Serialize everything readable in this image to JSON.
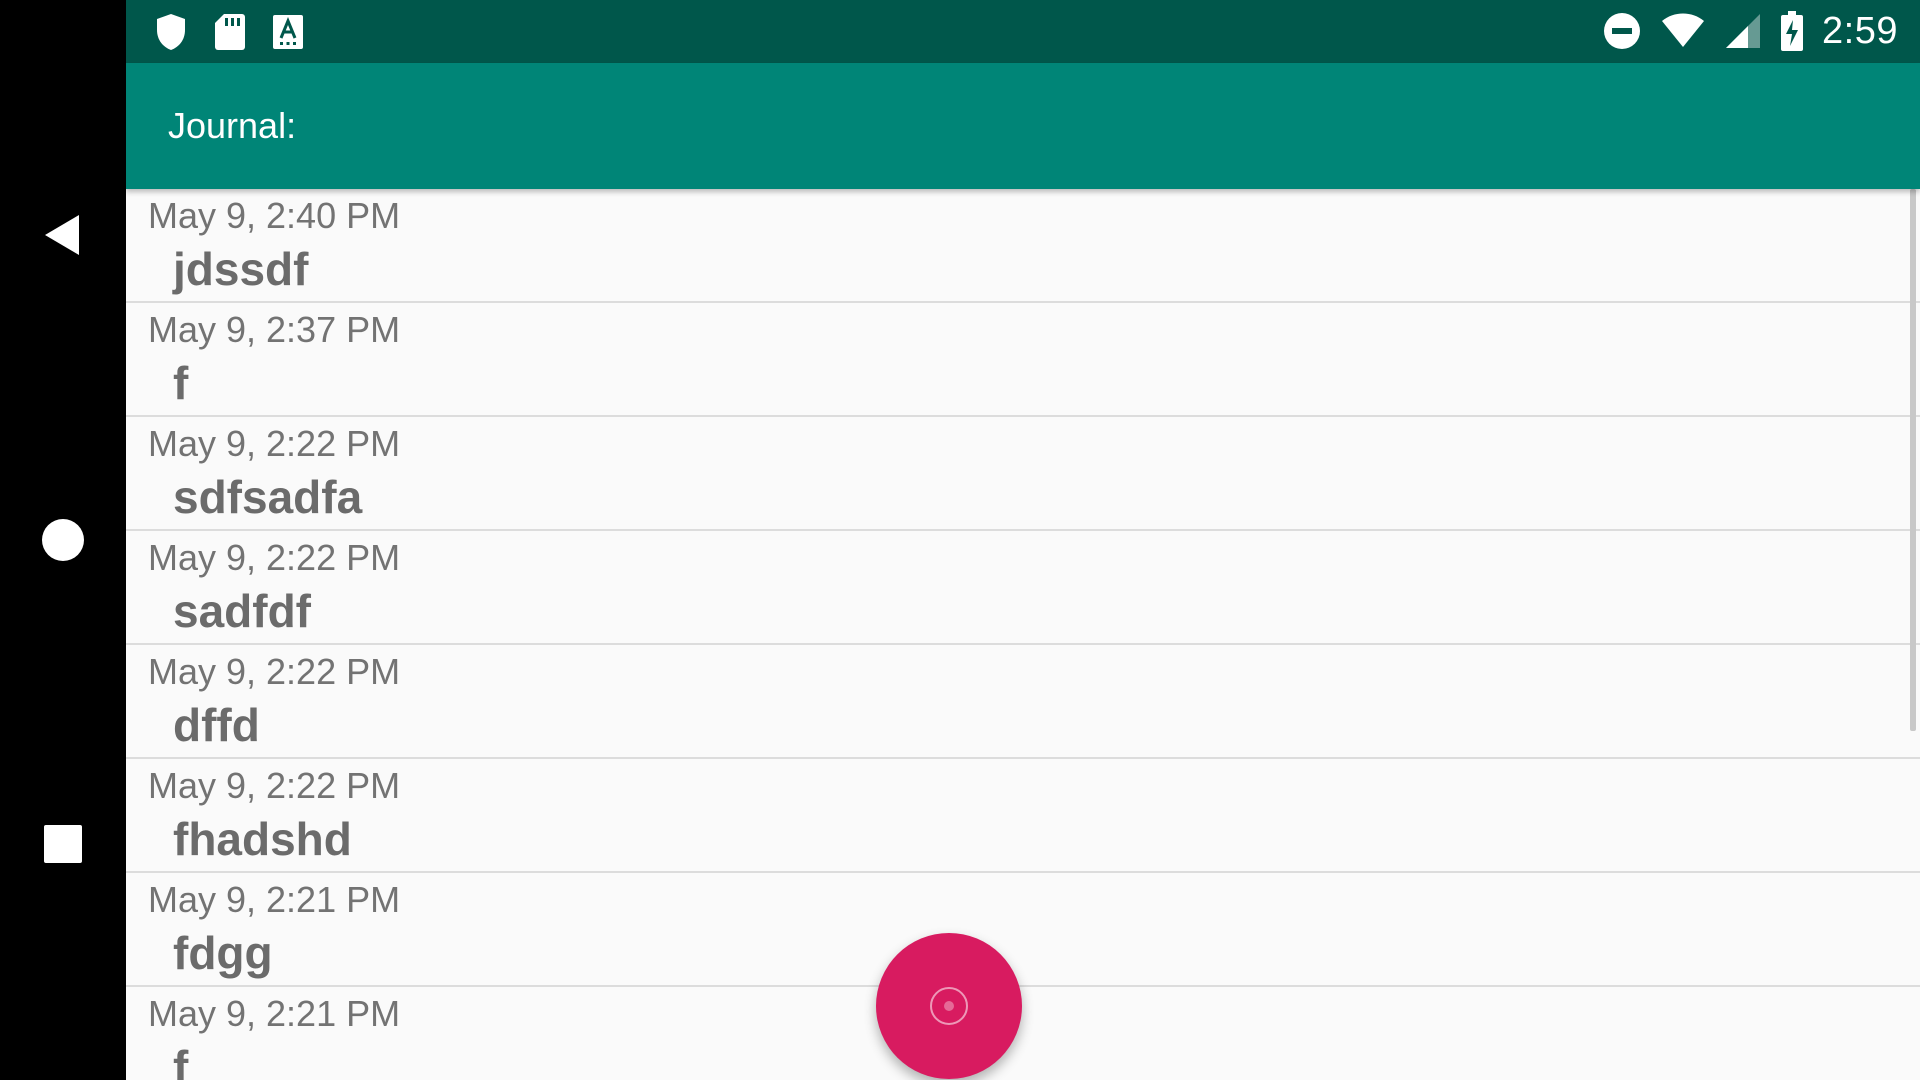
{
  "status_bar": {
    "time": "2:59",
    "left_icons": [
      "shield-icon",
      "sd-card-icon",
      "keyboard-a-icon"
    ],
    "right_icons": [
      "do-not-disturb-icon",
      "wifi-icon",
      "cell-signal-icon",
      "battery-charging-icon"
    ]
  },
  "nav_bar": {
    "icons": [
      "back-icon",
      "home-icon",
      "recents-icon"
    ]
  },
  "app_bar": {
    "title": "Journal:"
  },
  "entries": [
    {
      "date": "May 9, 2:40 PM",
      "text": "jdssdf"
    },
    {
      "date": "May 9, 2:37 PM",
      "text": "f"
    },
    {
      "date": "May 9, 2:22 PM",
      "text": "sdfsadfa"
    },
    {
      "date": "May 9, 2:22 PM",
      "text": "sadfdf"
    },
    {
      "date": "May 9, 2:22 PM",
      "text": "dffd"
    },
    {
      "date": "May 9, 2:22 PM",
      "text": "fhadshd"
    },
    {
      "date": "May 9, 2:21 PM",
      "text": "fdgg"
    },
    {
      "date": "May 9, 2:21 PM",
      "text": "f"
    }
  ],
  "fab": {
    "icon": "record-icon"
  },
  "colors": {
    "status_bar": "#00574b",
    "app_bar": "#008577",
    "fab": "#d81b60",
    "list_background": "#fafafa"
  }
}
